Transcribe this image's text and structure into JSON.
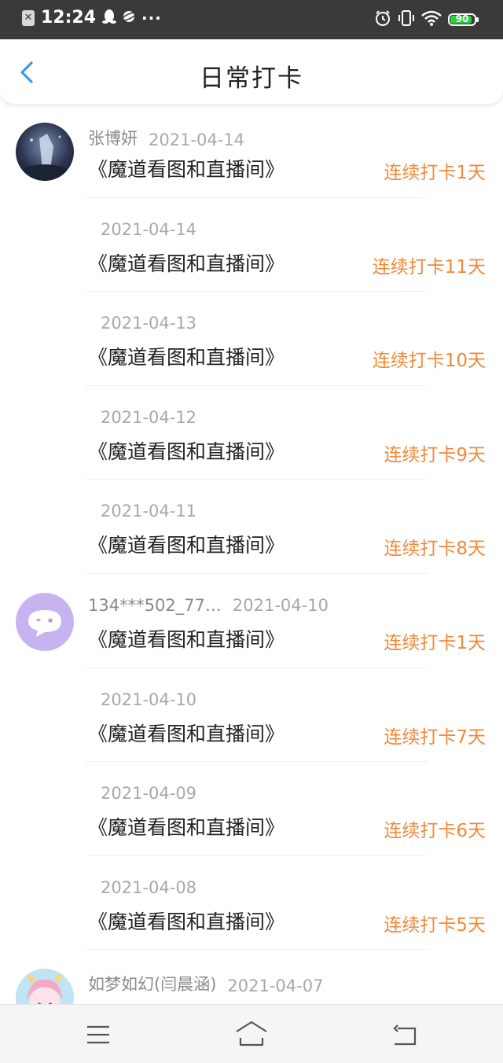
{
  "status_bar": {
    "time": "12:24",
    "battery": "90",
    "battery_level": 0.9,
    "icons_left": [
      "notification-x-icon",
      "qq-penguin-icon",
      "planet-icon",
      "more-dots-icon"
    ],
    "icons_right": [
      "alarm-icon",
      "vibrate-icon",
      "wifi-icon",
      "battery-icon"
    ],
    "more": "···"
  },
  "header": {
    "title": "日常打卡",
    "back_icon": "chevron-left-icon",
    "accent_color": "#3c9ae8"
  },
  "colors": {
    "streak": "#f0893a",
    "room": "#222222",
    "meta": "#9a9a9a"
  },
  "checkins": [
    {
      "user": "张博妍",
      "avatar": "anime-scene-avatar",
      "date": "2021-04-14",
      "room": "《魔道看图和直播间》",
      "streak": "连续打卡1天"
    },
    {
      "user": "",
      "date": "2021-04-14",
      "room": "《魔道看图和直播间》",
      "streak": "连续打卡11天"
    },
    {
      "user": "",
      "date": "2021-04-13",
      "room": "《魔道看图和直播间》",
      "streak": "连续打卡10天"
    },
    {
      "user": "",
      "date": "2021-04-12",
      "room": "《魔道看图和直播间》",
      "streak": "连续打卡9天"
    },
    {
      "user": "",
      "date": "2021-04-11",
      "room": "《魔道看图和直播间》",
      "streak": "连续打卡8天"
    },
    {
      "user": "134***502_77…",
      "avatar": "chat-bubble-avatar",
      "date": "2021-04-10",
      "room": "《魔道看图和直播间》",
      "streak": "连续打卡1天"
    },
    {
      "user": "",
      "date": "2021-04-10",
      "room": "《魔道看图和直播间》",
      "streak": "连续打卡7天"
    },
    {
      "user": "",
      "date": "2021-04-09",
      "room": "《魔道看图和直播间》",
      "streak": "连续打卡6天"
    },
    {
      "user": "",
      "date": "2021-04-08",
      "room": "《魔道看图和直播间》",
      "streak": "连续打卡5天"
    },
    {
      "user": "如梦如幻(闫晨涵)",
      "avatar": "anime-girl-avatar",
      "date": "2021-04-07",
      "room": "",
      "streak": ""
    }
  ],
  "nav_bar": {
    "buttons": [
      "menu-icon",
      "home-icon",
      "back-icon"
    ]
  }
}
